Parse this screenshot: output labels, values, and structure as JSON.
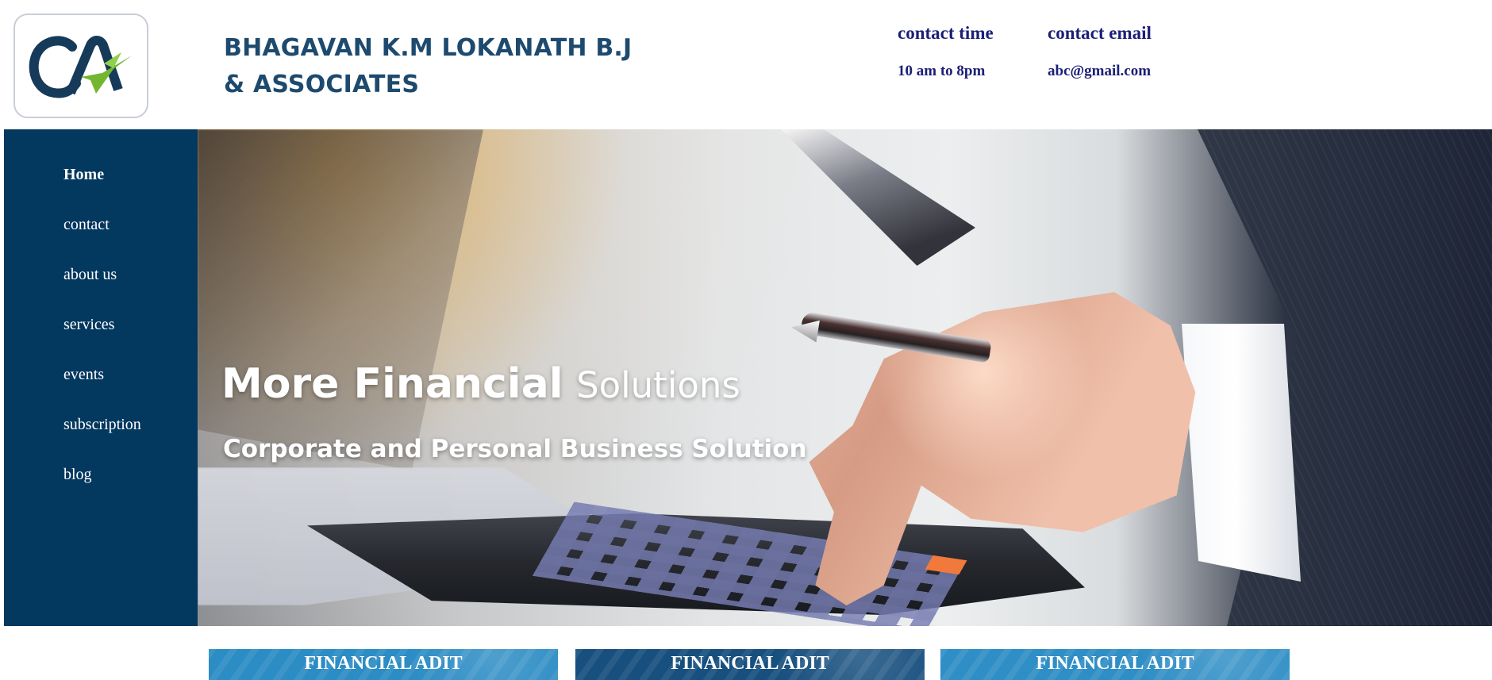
{
  "header": {
    "logo_text": "CA",
    "company_name_line1": "BHAGAVAN K.M  LOKANATH B.J",
    "company_name_line2": "& ASSOCIATES",
    "contact_time_label": "contact time",
    "contact_time_value": "10 am to 8pm",
    "contact_email_label": "contact email",
    "contact_email_value": "abc@gmail.com"
  },
  "sidebar": {
    "items": [
      {
        "label": "Home",
        "active": true
      },
      {
        "label": "contact"
      },
      {
        "label": "about us"
      },
      {
        "label": "services"
      },
      {
        "label": "events"
      },
      {
        "label": "subscription"
      },
      {
        "label": "blog"
      }
    ]
  },
  "hero": {
    "title_strong": "More Financial",
    "title_light": "Solutions",
    "subtitle": "Corporate and Personal Business Solution"
  },
  "cards": [
    {
      "title": "FINANCIAL ADIT"
    },
    {
      "title": "FINANCIAL ADIT"
    },
    {
      "title": "FINANCIAL ADIT"
    }
  ],
  "colors": {
    "sidebar": "#03385f",
    "company_text": "#1d4a6e",
    "contact_text": "#1b1f76",
    "logo_blue": "#163a5a",
    "logo_green": "#72b72f"
  },
  "icons": {
    "logo": "ca-logo-icon"
  }
}
